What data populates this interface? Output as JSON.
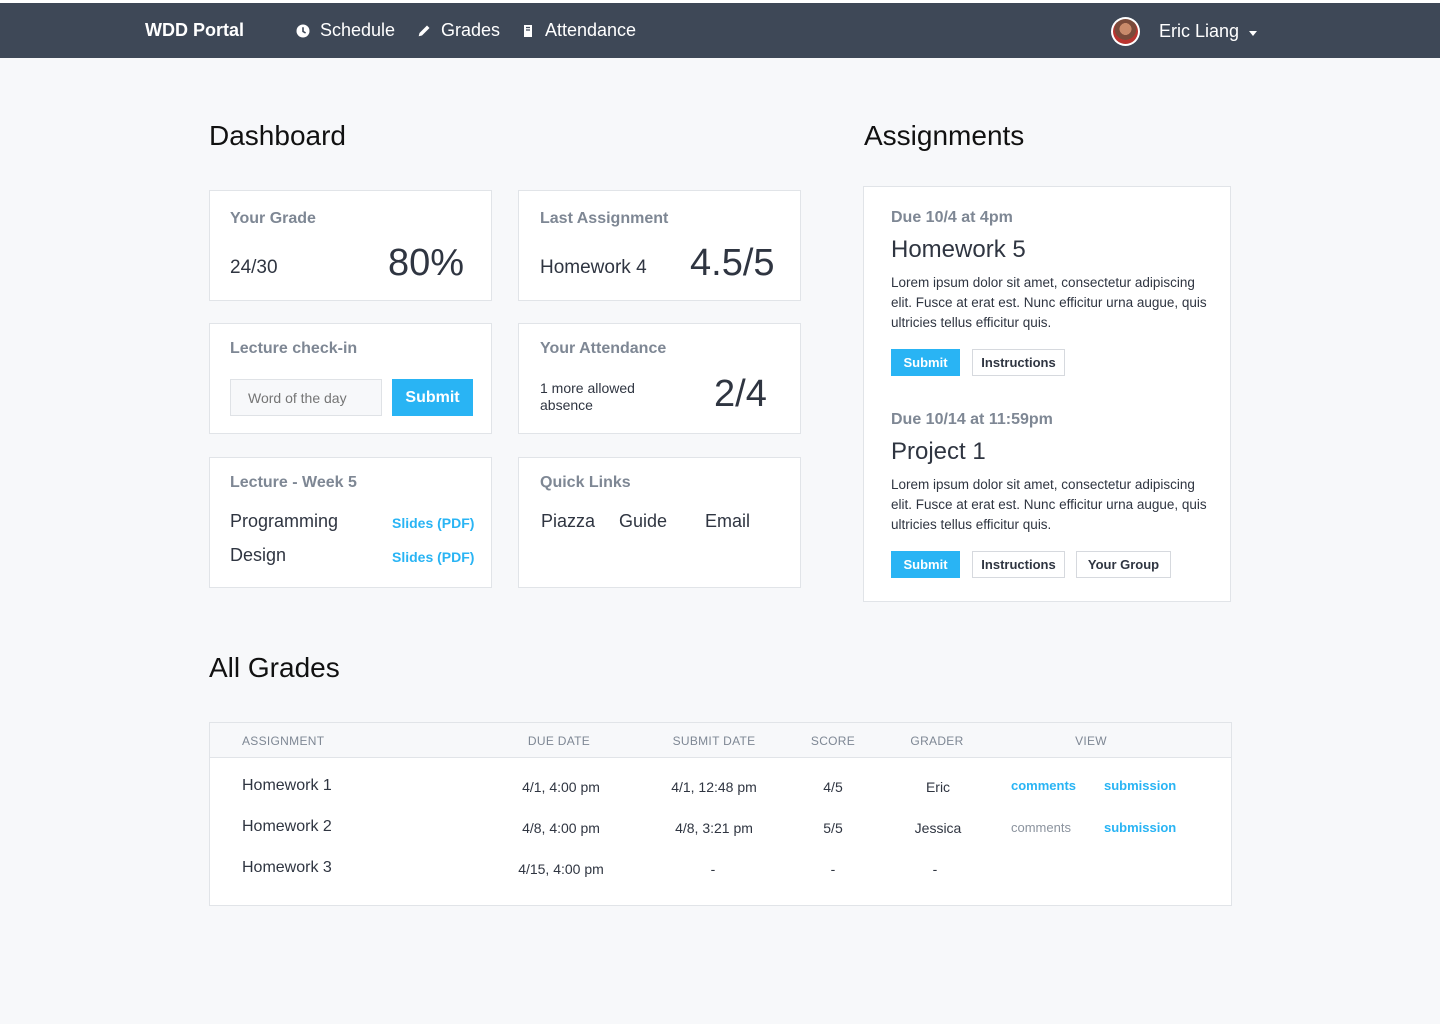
{
  "nav": {
    "brand": "WDD Portal",
    "items": [
      {
        "label": "Schedule",
        "icon": "clock-icon"
      },
      {
        "label": "Grades",
        "icon": "pencil-icon"
      },
      {
        "label": "Attendance",
        "icon": "notebook-icon"
      }
    ],
    "user_name": "Eric Liang"
  },
  "dashboard": {
    "title": "Dashboard",
    "your_grade": {
      "label": "Your Grade",
      "fraction": "24/30",
      "percent": "80%"
    },
    "last_assignment": {
      "label": "Last Assignment",
      "name": "Homework 4",
      "score": "4.5/5"
    },
    "checkin": {
      "label": "Lecture check-in",
      "placeholder": "Word of the day",
      "submit": "Submit"
    },
    "attendance": {
      "label": "Your Attendance",
      "note_line1": "1 more allowed",
      "note_line2": "absence",
      "value": "2/4"
    },
    "lecture": {
      "label": "Lecture - Week 5",
      "items": [
        {
          "name": "Programming",
          "link": "Slides (PDF)"
        },
        {
          "name": "Design",
          "link": "Slides (PDF)"
        }
      ]
    },
    "quick_links": {
      "label": "Quick Links",
      "links": [
        "Piazza",
        "Guide",
        "Email"
      ]
    }
  },
  "assignments": {
    "title": "Assignments",
    "items": [
      {
        "due": "Due 10/4 at 4pm",
        "title": "Homework 5",
        "desc": "Lorem ipsum dolor sit amet, consectetur adipiscing elit. Fusce at erat est. Nunc efficitur urna augue, quis ultricies tellus efficitur quis.",
        "submit": "Submit",
        "instructions": "Instructions"
      },
      {
        "due": "Due 10/14 at 11:59pm",
        "title": "Project 1",
        "desc": "Lorem ipsum dolor sit amet, consectetur adipiscing elit. Fusce at erat est. Nunc efficitur urna augue, quis ultricies tellus efficitur quis.",
        "submit": "Submit",
        "instructions": "Instructions",
        "group": "Your Group"
      }
    ]
  },
  "grades": {
    "title": "All Grades",
    "headers": [
      "ASSIGNMENT",
      "DUE DATE",
      "SUBMIT DATE",
      "SCORE",
      "GRADER",
      "VIEW"
    ],
    "rows": [
      {
        "assignment": "Homework 1",
        "due": "4/1, 4:00 pm",
        "submit": "4/1, 12:48 pm",
        "score": "4/5",
        "grader": "Eric",
        "comments": "comments",
        "submission": "submission"
      },
      {
        "assignment": "Homework 2",
        "due": "4/8, 4:00 pm",
        "submit": "4/8, 3:21 pm",
        "score": "5/5",
        "grader": "Jessica",
        "comments": "comments",
        "submission": "submission"
      },
      {
        "assignment": "Homework 3",
        "due": "4/15, 4:00 pm",
        "submit": "-",
        "score": "-",
        "grader": "-"
      }
    ]
  },
  "colors": {
    "accent": "#29b4f4",
    "navbar": "#3e4857",
    "muted": "#7e8794"
  }
}
